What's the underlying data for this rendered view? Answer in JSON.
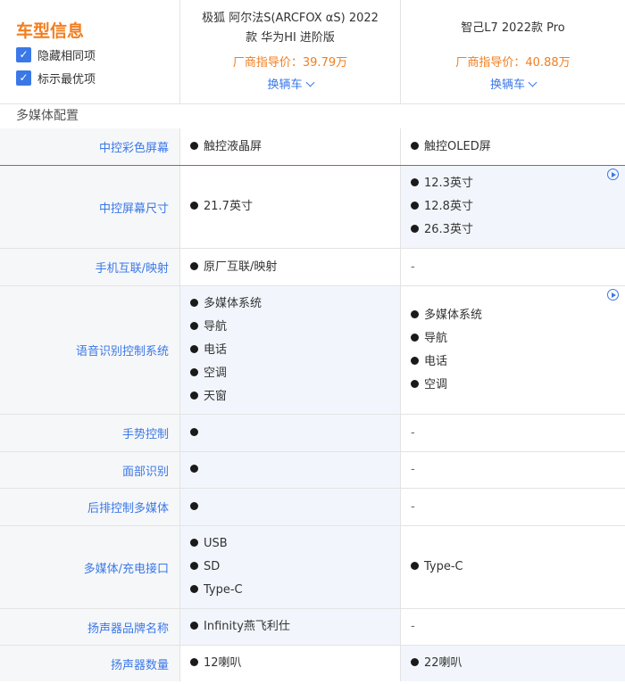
{
  "header": {
    "title": "车型信息",
    "options": [
      {
        "label": "隐藏相同项",
        "checked": true
      },
      {
        "label": "标示最优项",
        "checked": true
      }
    ],
    "cars": [
      {
        "name_line1": "极狐 阿尔法S(ARCFOX αS) 2022",
        "name_line2": "款 华为HI 进阶版",
        "price": "厂商指导价：39.79万",
        "change_label": "换辆车"
      },
      {
        "name_line1": "智己L7 2022款 Pro",
        "name_line2": "",
        "price": "厂商指导价：40.88万",
        "change_label": "换辆车"
      }
    ]
  },
  "section": {
    "title": "多媒体配置"
  },
  "rows": [
    {
      "label": "中控彩色屏幕",
      "a": [
        "触控液晶屏"
      ],
      "b": [
        "触控OLED屏"
      ]
    },
    {
      "label": "中控屏幕尺寸",
      "a": [
        "21.7英寸"
      ],
      "b": [
        "12.3英寸",
        "12.8英寸",
        "26.3英寸"
      ]
    },
    {
      "label": "手机互联/映射",
      "a": [
        "原厂互联/映射"
      ],
      "b": [],
      "b_empty": "-"
    },
    {
      "label": "语音识别控制系统",
      "a": [
        "多媒体系统",
        "导航",
        "电话",
        "空调",
        "天窗"
      ],
      "b": [
        "多媒体系统",
        "导航",
        "电话",
        "空调"
      ]
    },
    {
      "label": "手势控制",
      "a": [
        ""
      ],
      "b": [],
      "b_empty": "-"
    },
    {
      "label": "面部识别",
      "a": [
        ""
      ],
      "b": [],
      "b_empty": "-"
    },
    {
      "label": "后排控制多媒体",
      "a": [
        ""
      ],
      "b": [],
      "b_empty": "-"
    },
    {
      "label": "多媒体/充电接口",
      "a": [
        "USB",
        "SD",
        "Type-C"
      ],
      "b": [
        "Type-C"
      ]
    },
    {
      "label": "扬声器品牌名称",
      "a": [
        "Infinity燕飞利仕"
      ],
      "b": [],
      "b_empty": "-"
    },
    {
      "label": "扬声器数量",
      "a": [
        "12喇叭"
      ],
      "b": [
        "22喇叭"
      ]
    }
  ],
  "colors": {
    "accent": "#3b78e7",
    "price": "#f27e1e",
    "highlight_bg": "#f2f6fc",
    "separator_red": "#e04545"
  }
}
